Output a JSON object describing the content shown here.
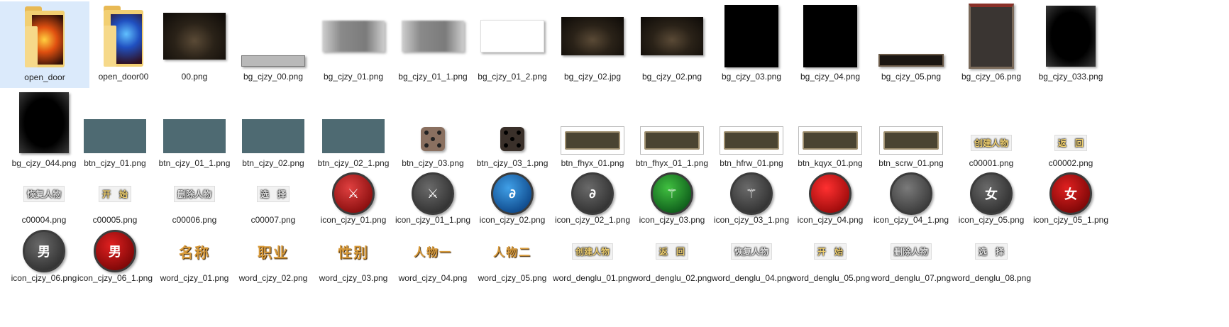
{
  "files": {
    "f01": "open_door",
    "f02": "open_door00",
    "f03": "00.png",
    "f04": "bg_cjzy_00.png",
    "f05": "bg_cjzy_01.png",
    "f06": "bg_cjzy_01_1.png",
    "f07": "bg_cjzy_01_2.png",
    "f08": "bg_cjzy_02.jpg",
    "f09": "bg_cjzy_02.png",
    "f10": "bg_cjzy_03.png",
    "f11": "bg_cjzy_04.png",
    "f12": "bg_cjzy_05.png",
    "f13": "bg_cjzy_06.png",
    "f14": "bg_cjzy_033.png",
    "f15": "bg_cjzy_044.png",
    "f16": "btn_cjzy_01.png",
    "f17": "btn_cjzy_01_1.png",
    "f18": "btn_cjzy_02.png",
    "f19": "btn_cjzy_02_1.png",
    "f20": "btn_cjzy_03.png",
    "f21": "btn_cjzy_03_1.png",
    "f22": "btn_fhyx_01.png",
    "f23": "btn_fhyx_01_1.png",
    "f24": "btn_hfrw_01.png",
    "f25": "btn_kqyx_01.png",
    "f26": "btn_scrw_01.png",
    "f27": "c00001.png",
    "f28": "c00002.png",
    "f29": "c00004.png",
    "f30": "c00005.png",
    "f31": "c00006.png",
    "f32": "c00007.png",
    "f33": "icon_cjzy_01.png",
    "f34": "icon_cjzy_01_1.png",
    "f35": "icon_cjzy_02.png",
    "f36": "icon_cjzy_02_1.png",
    "f37": "icon_cjzy_03.png",
    "f38": "icon_cjzy_03_1.png",
    "f39": "icon_cjzy_04.png",
    "f40": "icon_cjzy_04_1.png",
    "f41": "icon_cjzy_05.png",
    "f42": "icon_cjzy_05_1.png",
    "f43": "icon_cjzy_06.png",
    "f44": "icon_cjzy_06_1.png",
    "f45": "word_cjzy_01.png",
    "f46": "word_cjzy_02.png",
    "f47": "word_cjzy_03.png",
    "f48": "word_cjzy_04.png",
    "f49": "word_cjzy_05.png",
    "f50": "word_denglu_01.png",
    "f51": "word_denglu_02.png",
    "f52": "word_denglu_04.png",
    "f53": "word_denglu_05.png",
    "f54": "word_denglu_07.png",
    "f55": "word_denglu_08.png"
  },
  "thumb_text": {
    "c00001": "创建人物",
    "c00002": "返　回",
    "c00004": "恢复人物",
    "c00005": "开　始",
    "c00006": "删除人物",
    "c00007": "选　择",
    "icon05": "女",
    "icon05_1": "女",
    "icon06": "男",
    "icon06_1": "男",
    "word01": "名称",
    "word02": "职业",
    "word03": "性别",
    "word04": "人物一",
    "word05": "人物二",
    "denglu01": "创建人物",
    "denglu02": "返　回",
    "denglu04": "恢复人物",
    "denglu05": "开　始",
    "denglu07": "删除人物",
    "denglu08": "选　择"
  },
  "colors": {
    "selection": "#dbeafb",
    "button_teal": "#4e6a72",
    "gold_text": "#f0d070"
  }
}
